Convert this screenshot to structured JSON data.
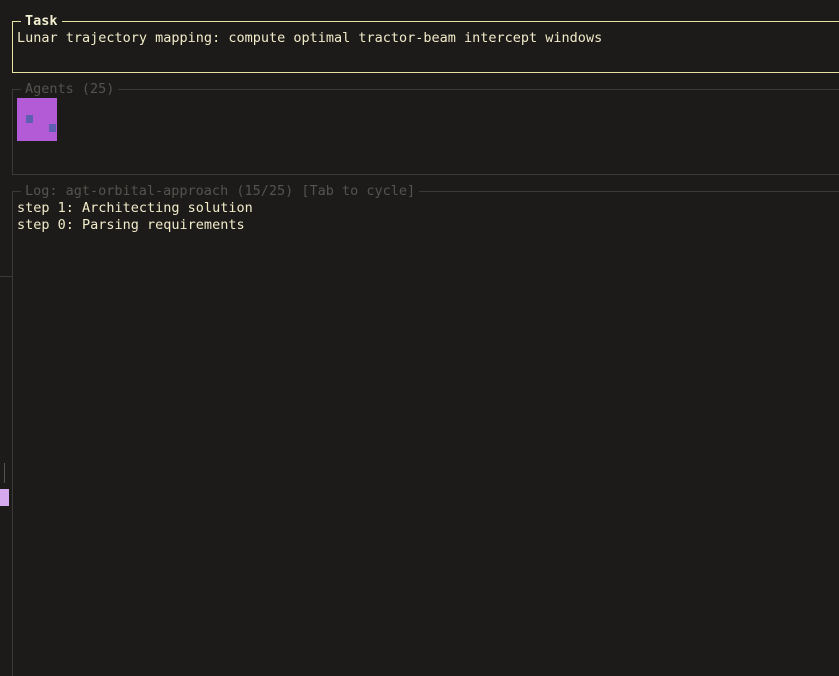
{
  "task": {
    "title": "Task",
    "description": "Lunar trajectory mapping: compute optimal tractor-beam intercept windows"
  },
  "agents": {
    "title": "Agents (25)",
    "tile_color": "#b35ad6"
  },
  "log": {
    "title": "Log: agt-orbital-approach (15/25) [Tab to cycle]",
    "lines": [
      "step 1: Architecting solution",
      "step 0: Parsing requirements"
    ]
  },
  "colors": {
    "background": "#1c1b1a",
    "accent_border": "#e9e3a6",
    "text": "#f1ebc8",
    "muted": "#55534f"
  }
}
